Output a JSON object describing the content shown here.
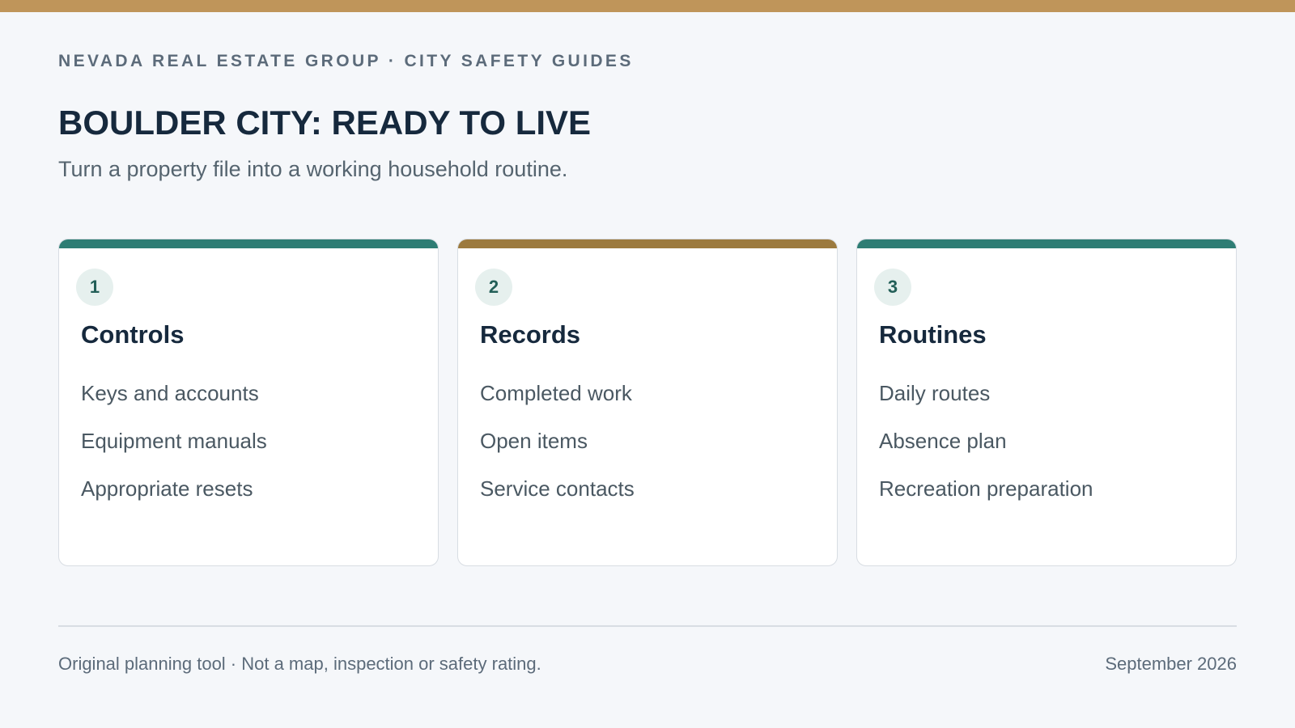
{
  "colors": {
    "top_bar": "#bf955a",
    "accent_teal": "#2e7d74",
    "accent_gold": "#9c7a3e"
  },
  "header": {
    "eyebrow": "NEVADA REAL ESTATE GROUP · CITY SAFETY GUIDES",
    "title": "BOULDER CITY: READY TO LIVE",
    "subtitle": "Turn a property file into a working household routine."
  },
  "cards": [
    {
      "number": "1",
      "title": "Controls",
      "accent": "#2e7d74",
      "items": [
        "Keys and accounts",
        "Equipment manuals",
        "Appropriate resets"
      ]
    },
    {
      "number": "2",
      "title": "Records",
      "accent": "#9c7a3e",
      "items": [
        "Completed work",
        "Open items",
        "Service contacts"
      ]
    },
    {
      "number": "3",
      "title": "Routines",
      "accent": "#2e7d74",
      "items": [
        "Daily routes",
        "Absence plan",
        "Recreation preparation"
      ]
    }
  ],
  "footer": {
    "disclaimer": "Original planning tool · Not a map, inspection or safety rating.",
    "date": "September 2026"
  }
}
